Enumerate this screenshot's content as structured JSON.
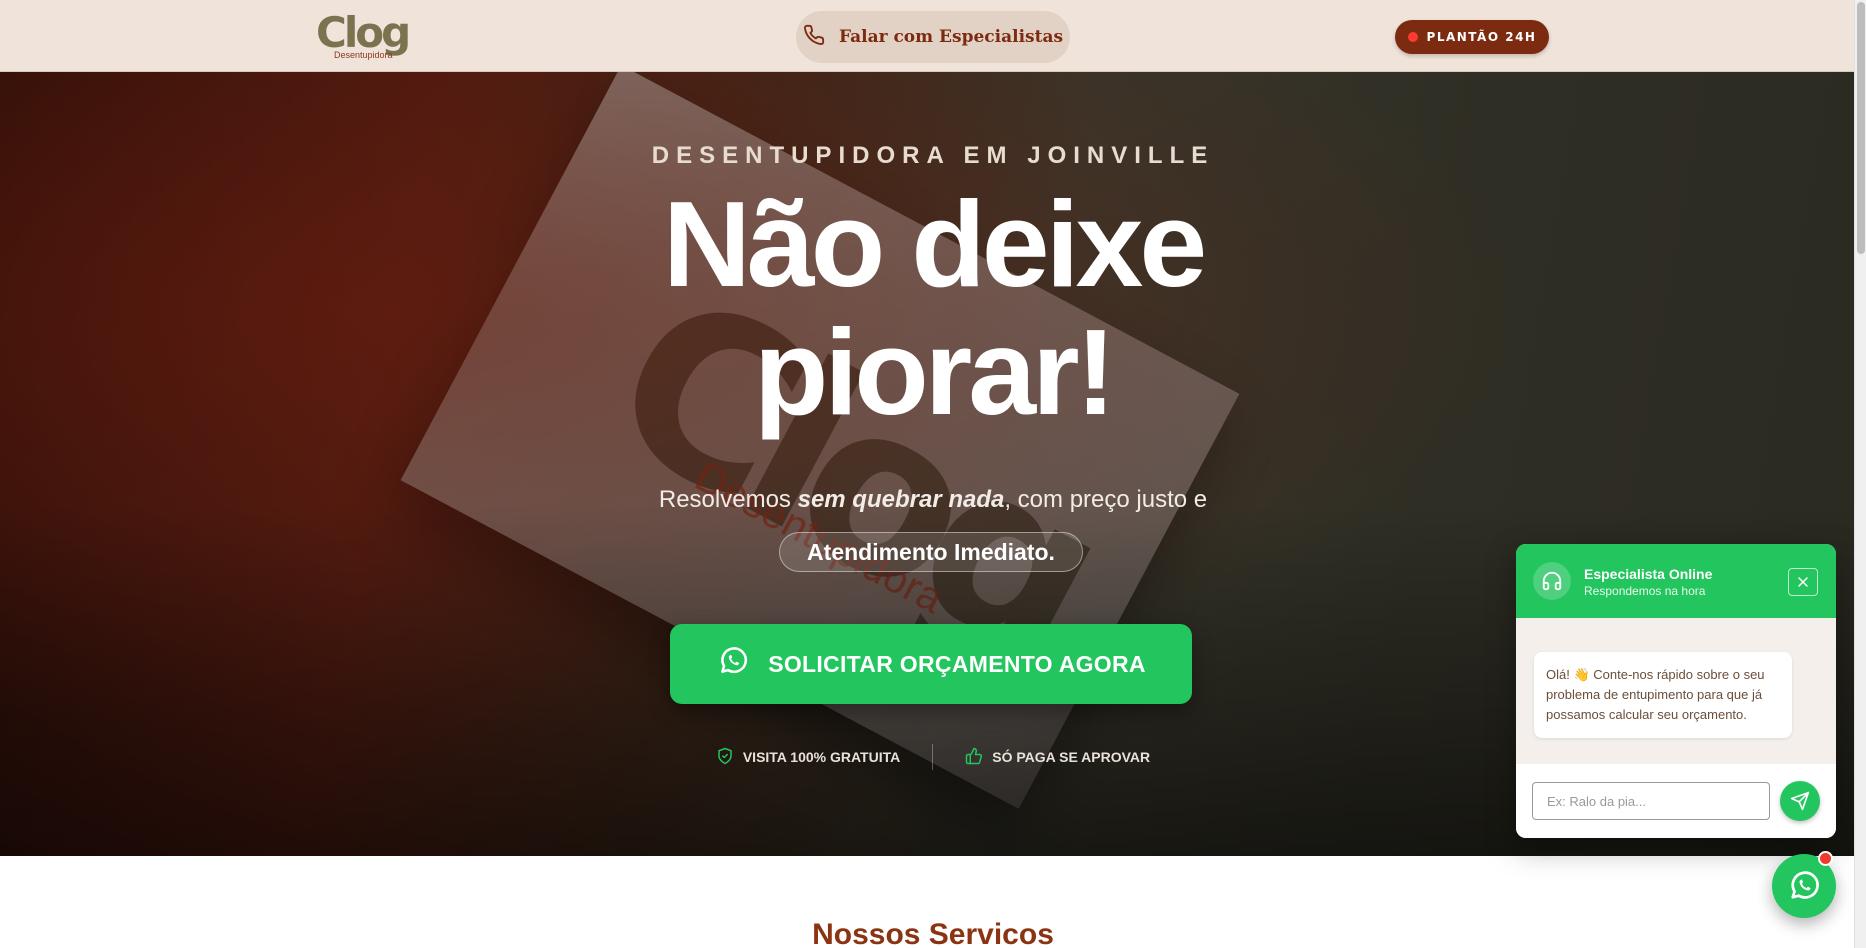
{
  "header": {
    "logo_text": "Clog",
    "logo_subtext": "Desentupidora",
    "call_button_label": "Falar com Especialistas",
    "plantao_label": "PLANTÃO 24H"
  },
  "hero": {
    "eyebrow": "DESENTUPIDORA EM JOINVILLE",
    "headline_line1": "Não deixe",
    "headline_line2": "piorar!",
    "subline_prefix": "Resolvemos ",
    "subline_emphasis": "sem quebrar nada",
    "subline_suffix": ", com preço justo e",
    "pill_text": "Atendimento Imediato.",
    "cta_label": "SOLICITAR ORÇAMENTO AGORA",
    "trust": [
      {
        "label": "VISITA 100% GRATUITA",
        "icon": "shield-check-icon"
      },
      {
        "label": "SÓ PAGA SE APROVAR",
        "icon": "thumbs-up-icon"
      }
    ]
  },
  "section": {
    "title": "Nossos Servicos"
  },
  "chat": {
    "title": "Especialista Online",
    "status": "Respondemos na hora",
    "message": "Olá! 👋 Conte-nos rápido sobre o seu problema de entupimento para que já possamos calcular seu orçamento.",
    "input_placeholder": "Ex: Ralo da pia..."
  },
  "colors": {
    "brand_brown": "#7c2a10",
    "whatsapp_green": "#22c55e",
    "header_bg": "#efe3da"
  }
}
